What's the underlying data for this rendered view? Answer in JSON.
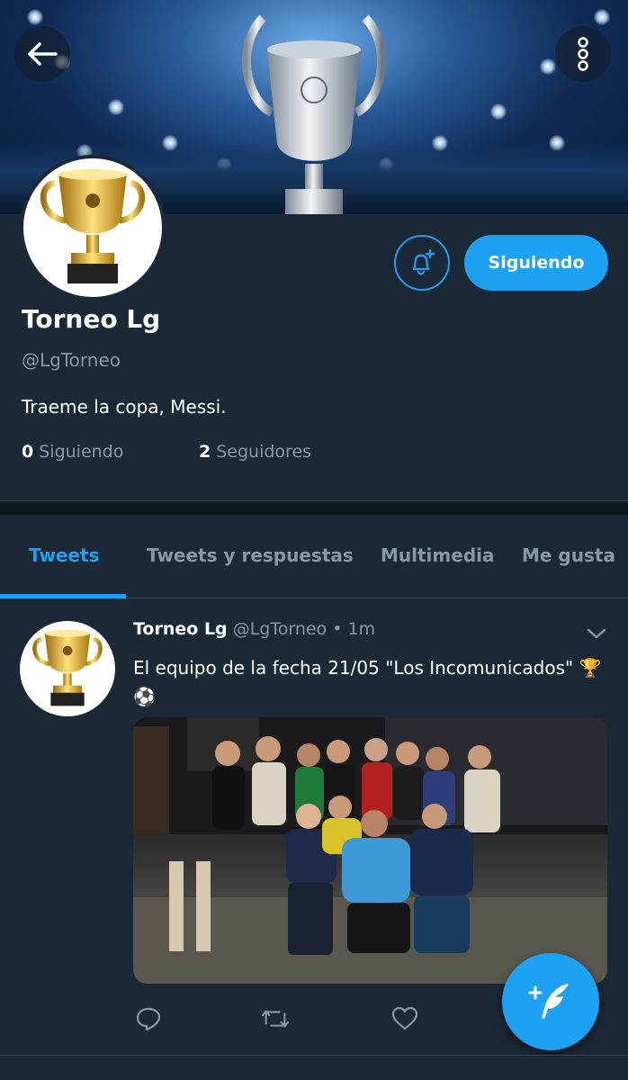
{
  "header": {
    "back_icon": "arrow-left-icon",
    "more_icon": "more-vertical-icon",
    "banner_image": "champions-league-trophy-banner"
  },
  "profile": {
    "avatar_image": "gold-trophy-cup",
    "display_name": "Torneo Lg",
    "handle": "@LgTorneo",
    "bio": "Traeme la copa, Messi.",
    "following_count": "0",
    "following_label": "Siguiendo",
    "followers_count": "2",
    "followers_label": "Seguidores",
    "notify_icon": "bell-plus-icon",
    "follow_button_label": "Siguiendo"
  },
  "tabs": [
    {
      "label": "Tweets",
      "active": true
    },
    {
      "label": "Tweets y respuestas",
      "active": false
    },
    {
      "label": "Multimedia",
      "active": false
    },
    {
      "label": "Me gusta",
      "active": false
    }
  ],
  "tweet": {
    "name": "Torneo Lg",
    "handle": "@LgTorneo",
    "dot": "•",
    "time": "1m",
    "text": "El equipo de la fecha 21/05 \"Los Incomunicados\" 🏆⚽",
    "media": "team-group-photo",
    "actions": [
      "reply-icon",
      "retweet-icon",
      "like-icon"
    ]
  },
  "compose_icon": "compose-tweet-icon",
  "colors": {
    "background": "#1b2836",
    "accent": "#1da1f2",
    "secondary_text": "#8899a6",
    "divider": "#10171e"
  }
}
